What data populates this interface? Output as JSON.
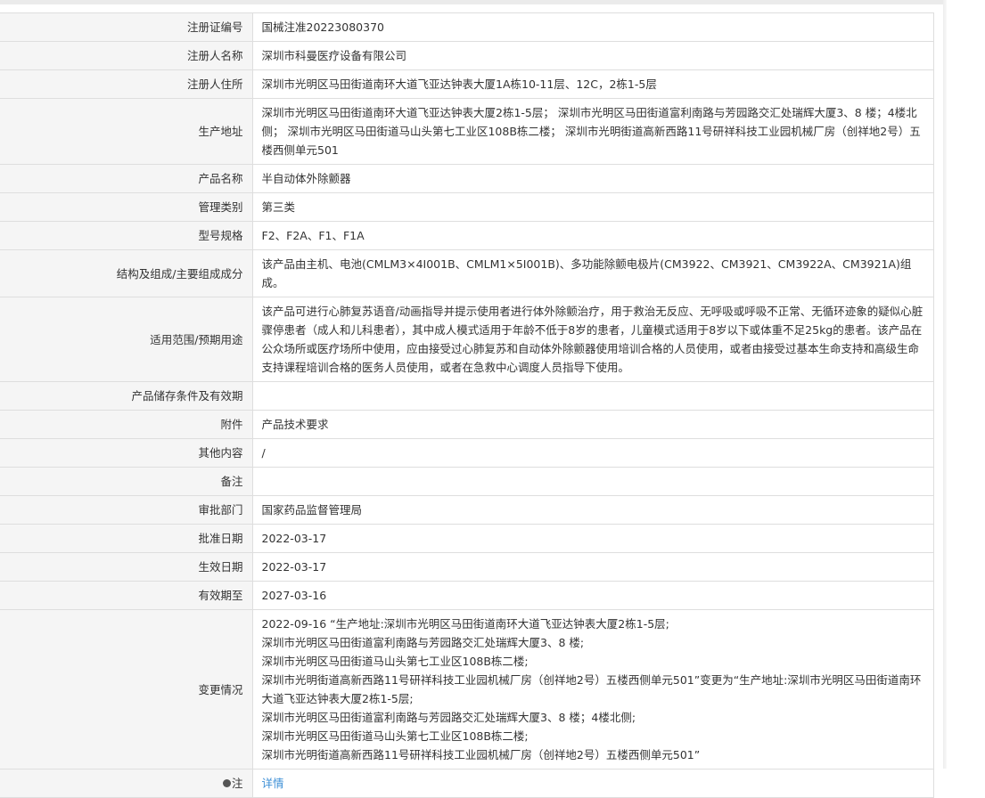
{
  "rows": {
    "reg_no": {
      "label": "注册证编号",
      "value": "国械注准20223080370"
    },
    "registrant": {
      "label": "注册人名称",
      "value": "深圳市科曼医疗设备有限公司"
    },
    "registrant_addr": {
      "label": "注册人住所",
      "value": "深圳市光明区马田街道南环大道飞亚达钟表大厦1A栋10-11层、12C，2栋1-5层"
    },
    "prod_addr": {
      "label": "生产地址",
      "value": "深圳市光明区马田街道南环大道飞亚达钟表大厦2栋1-5层； 深圳市光明区马田街道富利南路与芳园路交汇处瑞辉大厦3、8 楼；4楼北侧； 深圳市光明区马田街道马山头第七工业区108B栋二楼； 深圳市光明街道高新西路11号研祥科技工业园机械厂房（创祥地2号）五楼西侧单元501"
    },
    "product_name": {
      "label": "产品名称",
      "value": "半自动体外除颤器"
    },
    "mgmt_class": {
      "label": "管理类别",
      "value": "第三类"
    },
    "model": {
      "label": "型号规格",
      "value": "F2、F2A、F1、F1A"
    },
    "structure": {
      "label": "结构及组成/主要组成成分",
      "value": "该产品由主机、电池(CMLM3×4I001B、CMLM1×5I001B)、多功能除颤电极片(CM3922、CM3921、CM3922A、CM3921A)组成。"
    },
    "scope": {
      "label": "适用范围/预期用途",
      "value": "该产品可进行心肺复苏语音/动画指导并提示使用者进行体外除颤治疗，用于救治无反应、无呼吸或呼吸不正常、无循环迹象的疑似心脏骤停患者（成人和儿科患者），其中成人模式适用于年龄不低于8岁的患者，儿童模式适用于8岁以下或体重不足25kg的患者。该产品在公众场所或医疗场所中使用，应由接受过心肺复苏和自动体外除颤器使用培训合格的人员使用，或者由接受过基本生命支持和高级生命支持课程培训合格的医务人员使用，或者在急救中心调度人员指导下使用。"
    },
    "storage": {
      "label": "产品储存条件及有效期",
      "value": ""
    },
    "attachment": {
      "label": "附件",
      "value": "产品技术要求"
    },
    "other": {
      "label": "其他内容",
      "value": "/"
    },
    "remark": {
      "label": "备注",
      "value": ""
    },
    "approver": {
      "label": "审批部门",
      "value": "国家药品监督管理局"
    },
    "approval_date": {
      "label": "批准日期",
      "value": "2022-03-17"
    },
    "effective_date": {
      "label": "生效日期",
      "value": "2022-03-17"
    },
    "expiry_date": {
      "label": "有效期至",
      "value": "2027-03-16"
    },
    "changes": {
      "label": "变更情况",
      "lines": [
        "2022-09-16 “生产地址:深圳市光明区马田街道南环大道飞亚达钟表大厦2栋1-5层;",
        "深圳市光明区马田街道富利南路与芳园路交汇处瑞辉大厦3、8 楼;",
        "深圳市光明区马田街道马山头第七工业区108B栋二楼;",
        "深圳市光明街道高新西路11号研祥科技工业园机械厂房（创祥地2号）五楼西侧单元501”变更为“生产地址:深圳市光明区马田街道南环大道飞亚达钟表大厦2栋1-5层;",
        "深圳市光明区马田街道富利南路与芳园路交汇处瑞辉大厦3、8 楼；4楼北侧;",
        "深圳市光明区马田街道马山头第七工业区108B栋二楼;",
        "深圳市光明街道高新西路11号研祥科技工业园机械厂房（创祥地2号）五楼西侧单元501”"
      ]
    },
    "note": {
      "label": "注",
      "icon": "info-dot-icon",
      "link_text": "详情",
      "link_color": "#3d8fd6"
    }
  }
}
